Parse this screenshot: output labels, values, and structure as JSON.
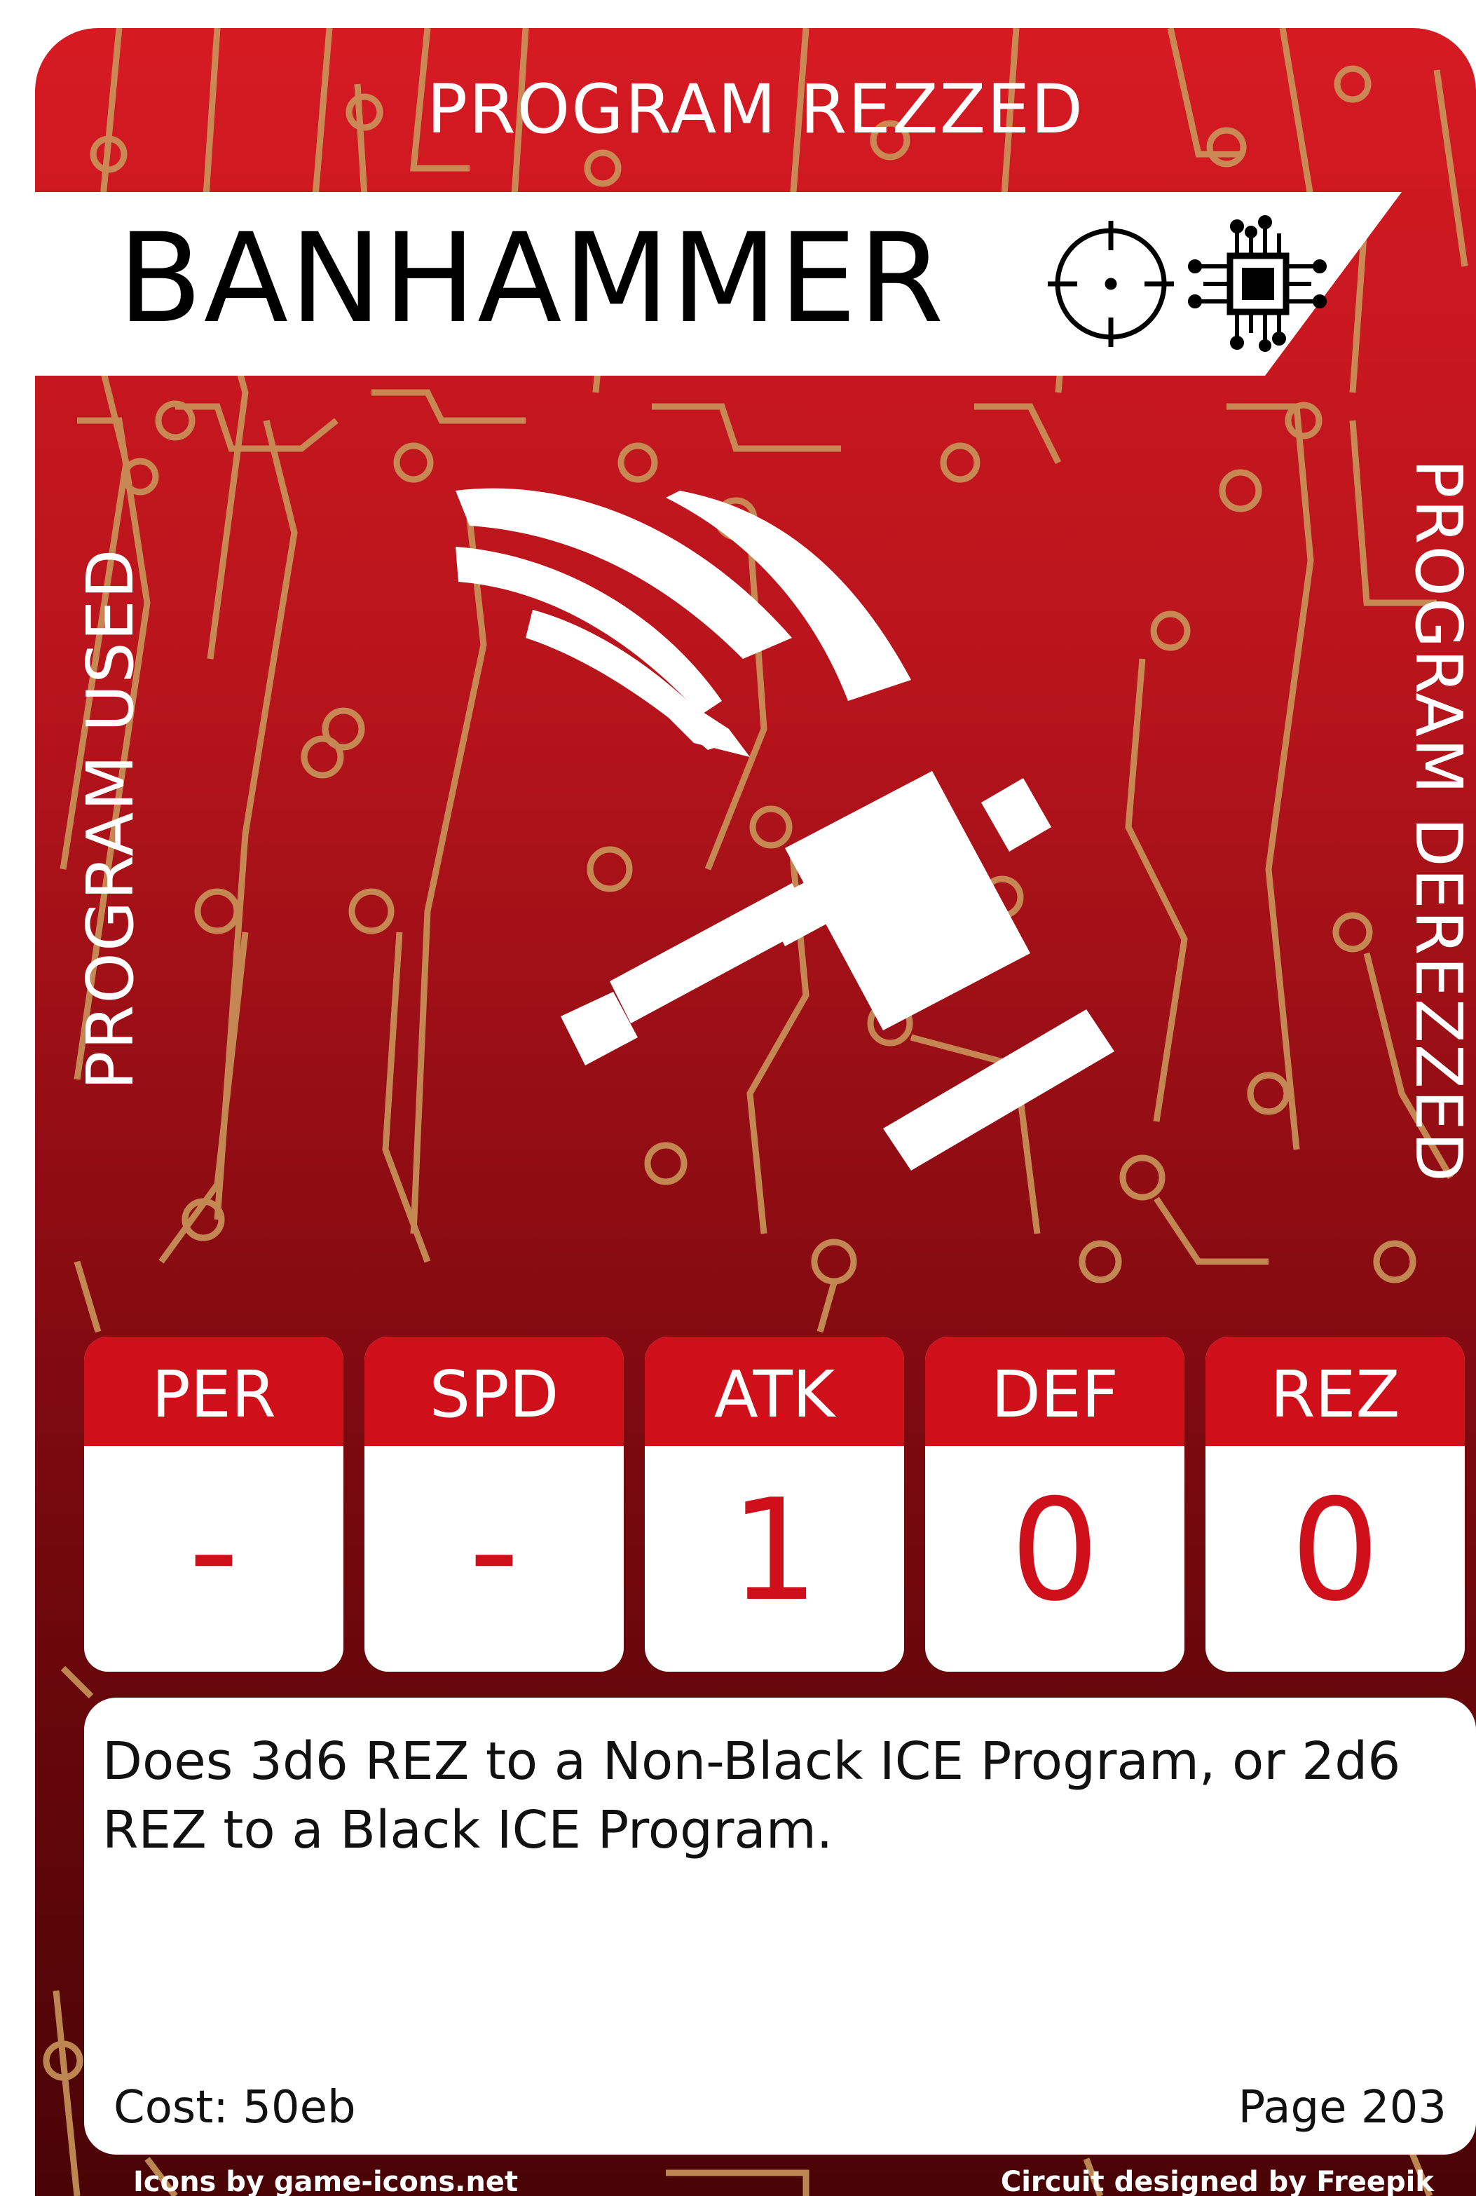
{
  "card": {
    "top_label": "PROGRAM REZZED",
    "title": "BANHAMMER",
    "left_label": "PROGRAM USED",
    "right_label": "PROGRAM DEREZZED",
    "icons": [
      "crosshair-icon",
      "chip-icon",
      "hammer-icon"
    ]
  },
  "stats": [
    {
      "label": "PER",
      "value": "-"
    },
    {
      "label": "SPD",
      "value": "-"
    },
    {
      "label": "ATK",
      "value": "1"
    },
    {
      "label": "DEF",
      "value": "0"
    },
    {
      "label": "REZ",
      "value": "0"
    }
  ],
  "ability": {
    "text": "Does 3d6 REZ to a Non-Black ICE Program, or 2d6 REZ to a Black ICE Program.",
    "cost": "Cost: 50eb",
    "page": "Page 203"
  },
  "credits": {
    "left": "Icons by game-icons.net",
    "right": "Circuit designed by Freepik"
  },
  "colors": {
    "card_red": "#d61a22",
    "stat_red": "#cf0f1a",
    "circuit_trace": "#c9955a"
  }
}
